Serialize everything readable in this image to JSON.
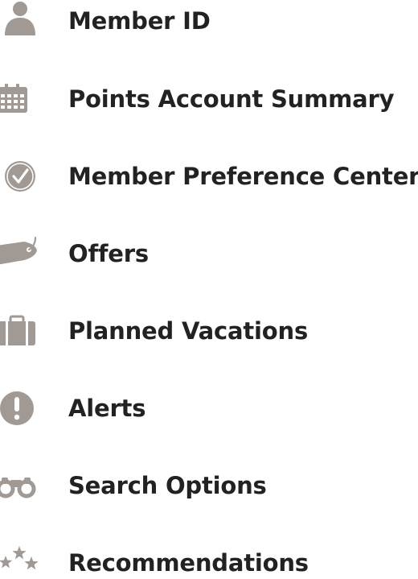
{
  "menu": {
    "icon_color": "#a19994",
    "text_color": "#222222",
    "items": [
      {
        "label": "Member ID",
        "icon": "person-icon"
      },
      {
        "label": "Points Account Summary",
        "icon": "calendar-icon"
      },
      {
        "label": "Member Preference Center",
        "icon": "checkmark-circle-icon"
      },
      {
        "label": "Offers",
        "icon": "tag-icon"
      },
      {
        "label": "Planned Vacations",
        "icon": "suitcase-icon"
      },
      {
        "label": "Alerts",
        "icon": "exclamation-icon"
      },
      {
        "label": "Search Options",
        "icon": "binoculars-icon"
      },
      {
        "label": "Recommendations",
        "icon": "stars-icon"
      }
    ]
  }
}
